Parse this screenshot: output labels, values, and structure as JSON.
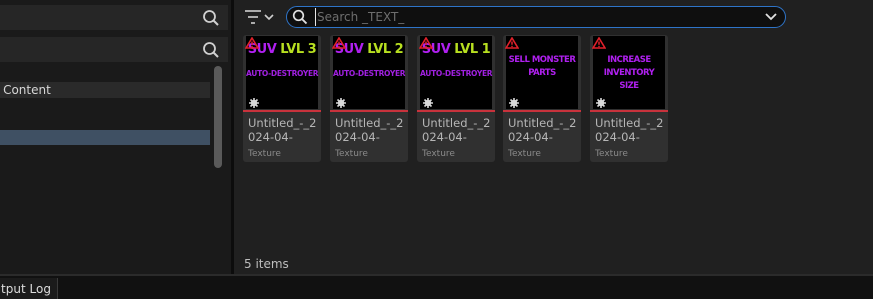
{
  "left_panel": {
    "tree_items": [
      {
        "label": "s Content",
        "selected": false
      },
      {
        "label": "",
        "selected": true
      }
    ]
  },
  "content_browser": {
    "search": {
      "placeholder": "Search _TEXT_",
      "value": ""
    },
    "assets": [
      {
        "name": "Untitled_-_2024-04-",
        "type": "Texture",
        "thumb_line1_a": "SUV",
        "thumb_line1_b": "LVL 3",
        "thumb_line2": "AUTO-DESTROYER",
        "warning": true
      },
      {
        "name": "Untitled_-_2024-04-",
        "type": "Texture",
        "thumb_line1_a": "SUV",
        "thumb_line1_b": "LVL 2",
        "thumb_line2": "AUTO-DESTROYER",
        "warning": true
      },
      {
        "name": "Untitled_-_2024-04-",
        "type": "Texture",
        "thumb_line1_a": "SUV",
        "thumb_line1_b": "LVL 1",
        "thumb_line2": "AUTO-DESTROYER",
        "warning": true
      },
      {
        "name": "Untitled_-_2024-04-",
        "type": "Texture",
        "thumb_line1_a": "SELL MONSTER PARTS",
        "thumb_line1_b": "",
        "thumb_line2": "",
        "warning": true
      },
      {
        "name": "Untitled_-_2024-04-",
        "type": "Texture",
        "thumb_line1_a": "INCREASE INVENTORY SIZE",
        "thumb_line1_b": "",
        "thumb_line2": "",
        "warning": true
      }
    ],
    "item_count": "5 items"
  },
  "bottom_bar": {
    "tabs": [
      {
        "label": "Output Log"
      }
    ]
  },
  "colors": {
    "accent": "#2e74c8",
    "selection": "#3f5063",
    "asset_texture": "#c8323c",
    "warning": "#e0202a"
  },
  "icons": [
    "search-icon",
    "filter-icon",
    "chevron-down-icon",
    "warning-icon",
    "gear-icon"
  ]
}
